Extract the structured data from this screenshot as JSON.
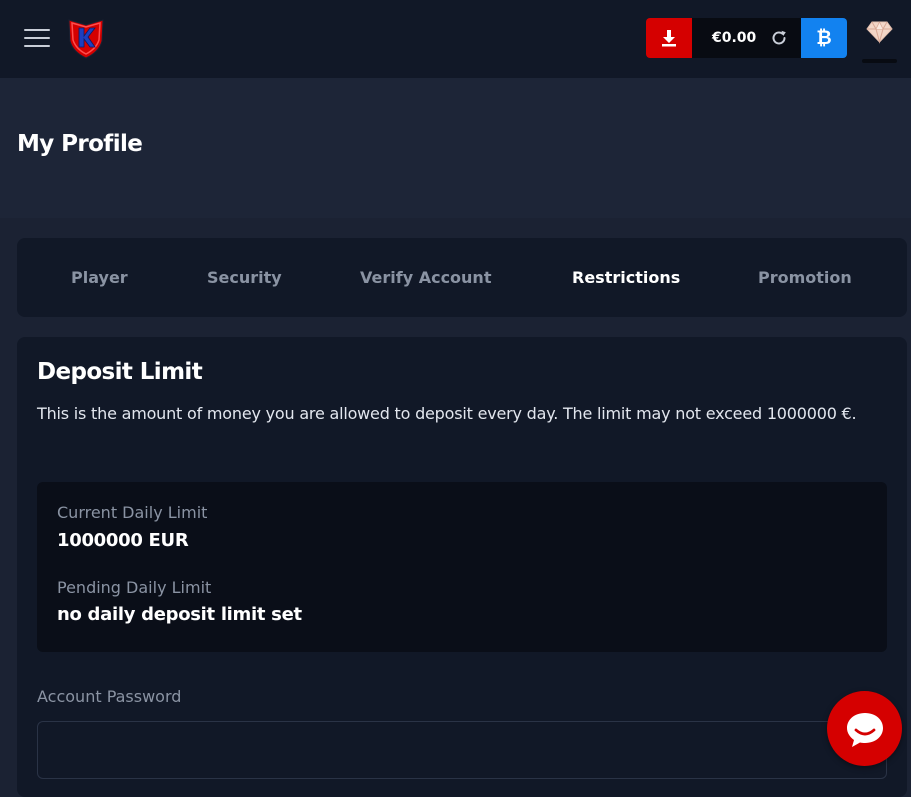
{
  "header": {
    "balance": "€0.00",
    "crypto_symbol": "₿"
  },
  "page": {
    "title": "My Profile"
  },
  "tabs": [
    {
      "label": "Player",
      "active": false
    },
    {
      "label": "Security",
      "active": false
    },
    {
      "label": "Verify Account",
      "active": false
    },
    {
      "label": "Restrictions",
      "active": true
    },
    {
      "label": "Promotion",
      "active": false
    }
  ],
  "deposit_limit": {
    "title": "Deposit Limit",
    "description": "This is the amount of money you are allowed to deposit every day. The limit may not exceed 1000000 €.",
    "current_label": "Current Daily Limit",
    "current_value": "1000000 EUR",
    "pending_label": "Pending Daily Limit",
    "pending_value": "no daily deposit limit set",
    "password_label": "Account Password",
    "password_value": "",
    "password_placeholder": ""
  },
  "icons": {
    "menu": "hamburger-menu-icon",
    "logo": "k-shield-logo",
    "download": "download-icon",
    "refresh": "refresh-icon",
    "crypto": "bitcoin-icon",
    "vip": "diamond-icon",
    "chat": "chat-bubble-icon"
  },
  "colors": {
    "background": "#1b2233",
    "panel": "#111827",
    "header": "#111827",
    "accent_red": "#d50000",
    "accent_blue": "#1282f0",
    "muted_text": "#8a93a3"
  }
}
